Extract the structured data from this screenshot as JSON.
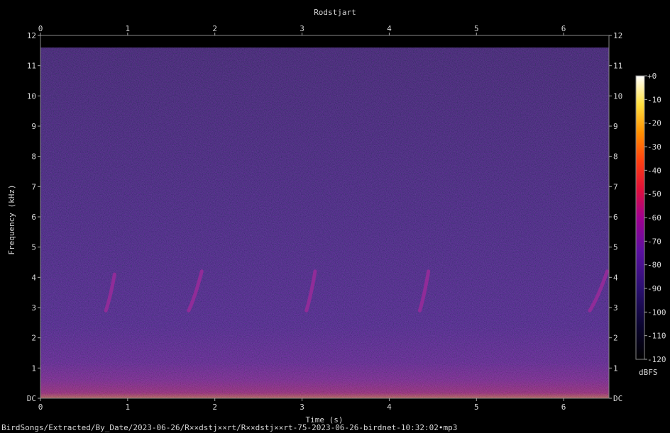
{
  "chart_data": {
    "type": "heatmap",
    "title": "Rodstjart",
    "xlabel": "Time (s)",
    "ylabel": "Frequency (kHz)",
    "xlim": [
      0,
      6.52
    ],
    "ylim": [
      0,
      12
    ],
    "x_ticks": [
      "0",
      "1",
      "2",
      "3",
      "4",
      "5",
      "6"
    ],
    "y_ticks": [
      "DC",
      "1",
      "2",
      "3",
      "4",
      "5",
      "6",
      "7",
      "8",
      "9",
      "10",
      "11",
      "12"
    ],
    "colorbar": {
      "label": "dBFS",
      "range": [
        -120,
        0
      ],
      "ticks": [
        "+0",
        "-10",
        "-20",
        "-30",
        "-40",
        "-50",
        "-60",
        "-70",
        "-80",
        "-90",
        "-100",
        "-110",
        "-120"
      ]
    },
    "calls": [
      {
        "t_start": 0.75,
        "t_end": 0.85,
        "f_low": 2.9,
        "f_high": 4.1
      },
      {
        "t_start": 1.7,
        "t_end": 1.85,
        "f_low": 2.9,
        "f_high": 4.2
      },
      {
        "t_start": 3.05,
        "t_end": 3.15,
        "f_low": 2.9,
        "f_high": 4.2
      },
      {
        "t_start": 4.35,
        "t_end": 4.45,
        "f_low": 2.9,
        "f_high": 4.2
      },
      {
        "t_start": 6.3,
        "t_end": 6.5,
        "f_low": 2.9,
        "f_high": 4.2
      }
    ]
  },
  "footer": "BirdSongs/Extracted/By_Date/2023-06-26/R××dstj××rt/R××dstj××rt-75-2023-06-26-birdnet-10:32:02•mp3",
  "colors": {
    "background": "#000000",
    "noise_floor": "#2a1575",
    "hot": "#ffe060"
  }
}
